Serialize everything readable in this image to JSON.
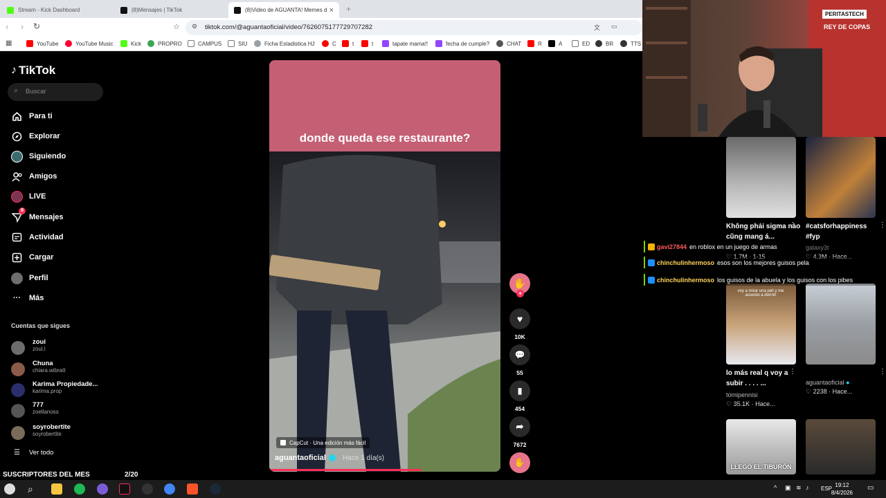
{
  "browser": {
    "tabs": [
      {
        "title": "Stream - Kick Dashboard",
        "color": "#53fc18"
      },
      {
        "title": "(8)Mensajes | TikTok",
        "color": "#111111"
      },
      {
        "title": "(8)Video de AGUANTA! Memes d",
        "color": "#111111"
      }
    ],
    "url": "tiktok.com/@aguantaoficial/video/7626075177729707282",
    "bookmarks": [
      {
        "label": "YouTube",
        "color": "#ff0000"
      },
      {
        "label": "YouTube Music",
        "color": "#ff0033"
      },
      {
        "label": "Kick",
        "color": "#53fc18"
      },
      {
        "label": "PROPRO",
        "color": "#3aa655"
      },
      {
        "label": "CAMPUS",
        "color": "#888888"
      },
      {
        "label": "SIU",
        "color": "#888888"
      },
      {
        "label": "Ficha Estadistica HJ",
        "color": "#9aa0a6"
      },
      {
        "label": "C",
        "color": "#ff0000"
      },
      {
        "label": "t",
        "color": "#ff0000"
      },
      {
        "label": "t",
        "color": "#ff0000"
      },
      {
        "label": "tapate mama!!",
        "color": "#9146ff"
      },
      {
        "label": "fecha de cumple?",
        "color": "#9146ff"
      },
      {
        "label": "CHAT",
        "color": "#555555"
      },
      {
        "label": "R",
        "color": "#ff0000"
      },
      {
        "label": "A",
        "color": "#000000"
      },
      {
        "label": "ED",
        "color": "#888888"
      },
      {
        "label": "BR",
        "color": "#333333"
      },
      {
        "label": "TTS",
        "color": "#333333"
      }
    ]
  },
  "tiktok": {
    "logo": "TikTok",
    "search_placeholder": "Buscar",
    "nav": [
      {
        "label": "Para ti",
        "icon": "home-icon"
      },
      {
        "label": "Explorar",
        "icon": "compass-icon"
      },
      {
        "label": "Siguiendo",
        "icon": "following-icon"
      },
      {
        "label": "Amigos",
        "icon": "friends-icon"
      },
      {
        "label": "LIVE",
        "icon": "live-icon"
      },
      {
        "label": "Mensajes",
        "icon": "messages-icon",
        "badge": "8"
      },
      {
        "label": "Actividad",
        "icon": "activity-icon"
      },
      {
        "label": "Cargar",
        "icon": "upload-icon"
      },
      {
        "label": "Perfil",
        "icon": "profile-icon"
      },
      {
        "label": "Más",
        "icon": "more-icon"
      }
    ],
    "following_title": "Cuentas que sigues",
    "accounts": [
      {
        "name": "zoui",
        "handle": "zoui.l",
        "color": "#6d6d6d"
      },
      {
        "name": "Chuna",
        "handle": "chiara.wibratt",
        "color": "#8a5a4a"
      },
      {
        "name": "Karima Propiedade...",
        "handle": "karima.prop",
        "color": "#2a2f6b"
      },
      {
        "name": "777",
        "handle": "zoellanoss",
        "color": "#555555"
      },
      {
        "name": "soyrobertite",
        "handle": "soyrobertite",
        "color": "#7a6a5a"
      }
    ],
    "see_all": "Ver todo",
    "video": {
      "caption": "donde queda ese restaurante?",
      "capcut": "CapCut · Una edición más fácil",
      "author": "aguantaoficial",
      "time": "· Hace 1 día(s)",
      "progress": 0.66
    },
    "actions": {
      "likes": "10K",
      "comments": "55",
      "saves": "454",
      "shares": "7672"
    }
  },
  "grid": [
    {
      "caption": "Không phải sigma nào cũng mang á...",
      "author": "",
      "stats": "1.7M · 1-15"
    },
    {
      "caption": "#catsforhappiness #fyp",
      "author": "galaxy3t",
      "stats": "4.3M · Hace..."
    },
    {
      "caption": "lo más real q voy a subir . . . . ...",
      "author": "tomipennisi",
      "stats": "35.1K · Hace..."
    },
    {
      "caption": "",
      "author": "aguantaoficial",
      "stats": "2238 · Hace..."
    }
  ],
  "thumb_texts": {
    "third_overlay": "voy a mirar una peli y me acuesto a dormir",
    "fifth_overlay": "LLEGÓ EL TIBURÓN"
  },
  "chat": [
    {
      "user": "gavi27844",
      "message": "en roblox en un juego de armas",
      "color": "#ff5a5a"
    },
    {
      "user": "chinchulinhermoso",
      "message": "esos son los mejores guisos pela",
      "color": "#ffd35a"
    },
    {
      "user": "chinchulinhermoso",
      "message": "los guisos de la abuela y los guisos con los pibes",
      "color": "#ffd35a"
    }
  ],
  "webcam": {
    "banner": "PERITASTECH",
    "flag": "REY DE COPAS"
  },
  "stream": {
    "subs_label": "SUSCRIPTORES DEL MES",
    "subs_count": "2/20"
  },
  "taskbar": {
    "lang": "ESP",
    "time": "19:12",
    "date": "8/4/2026"
  }
}
